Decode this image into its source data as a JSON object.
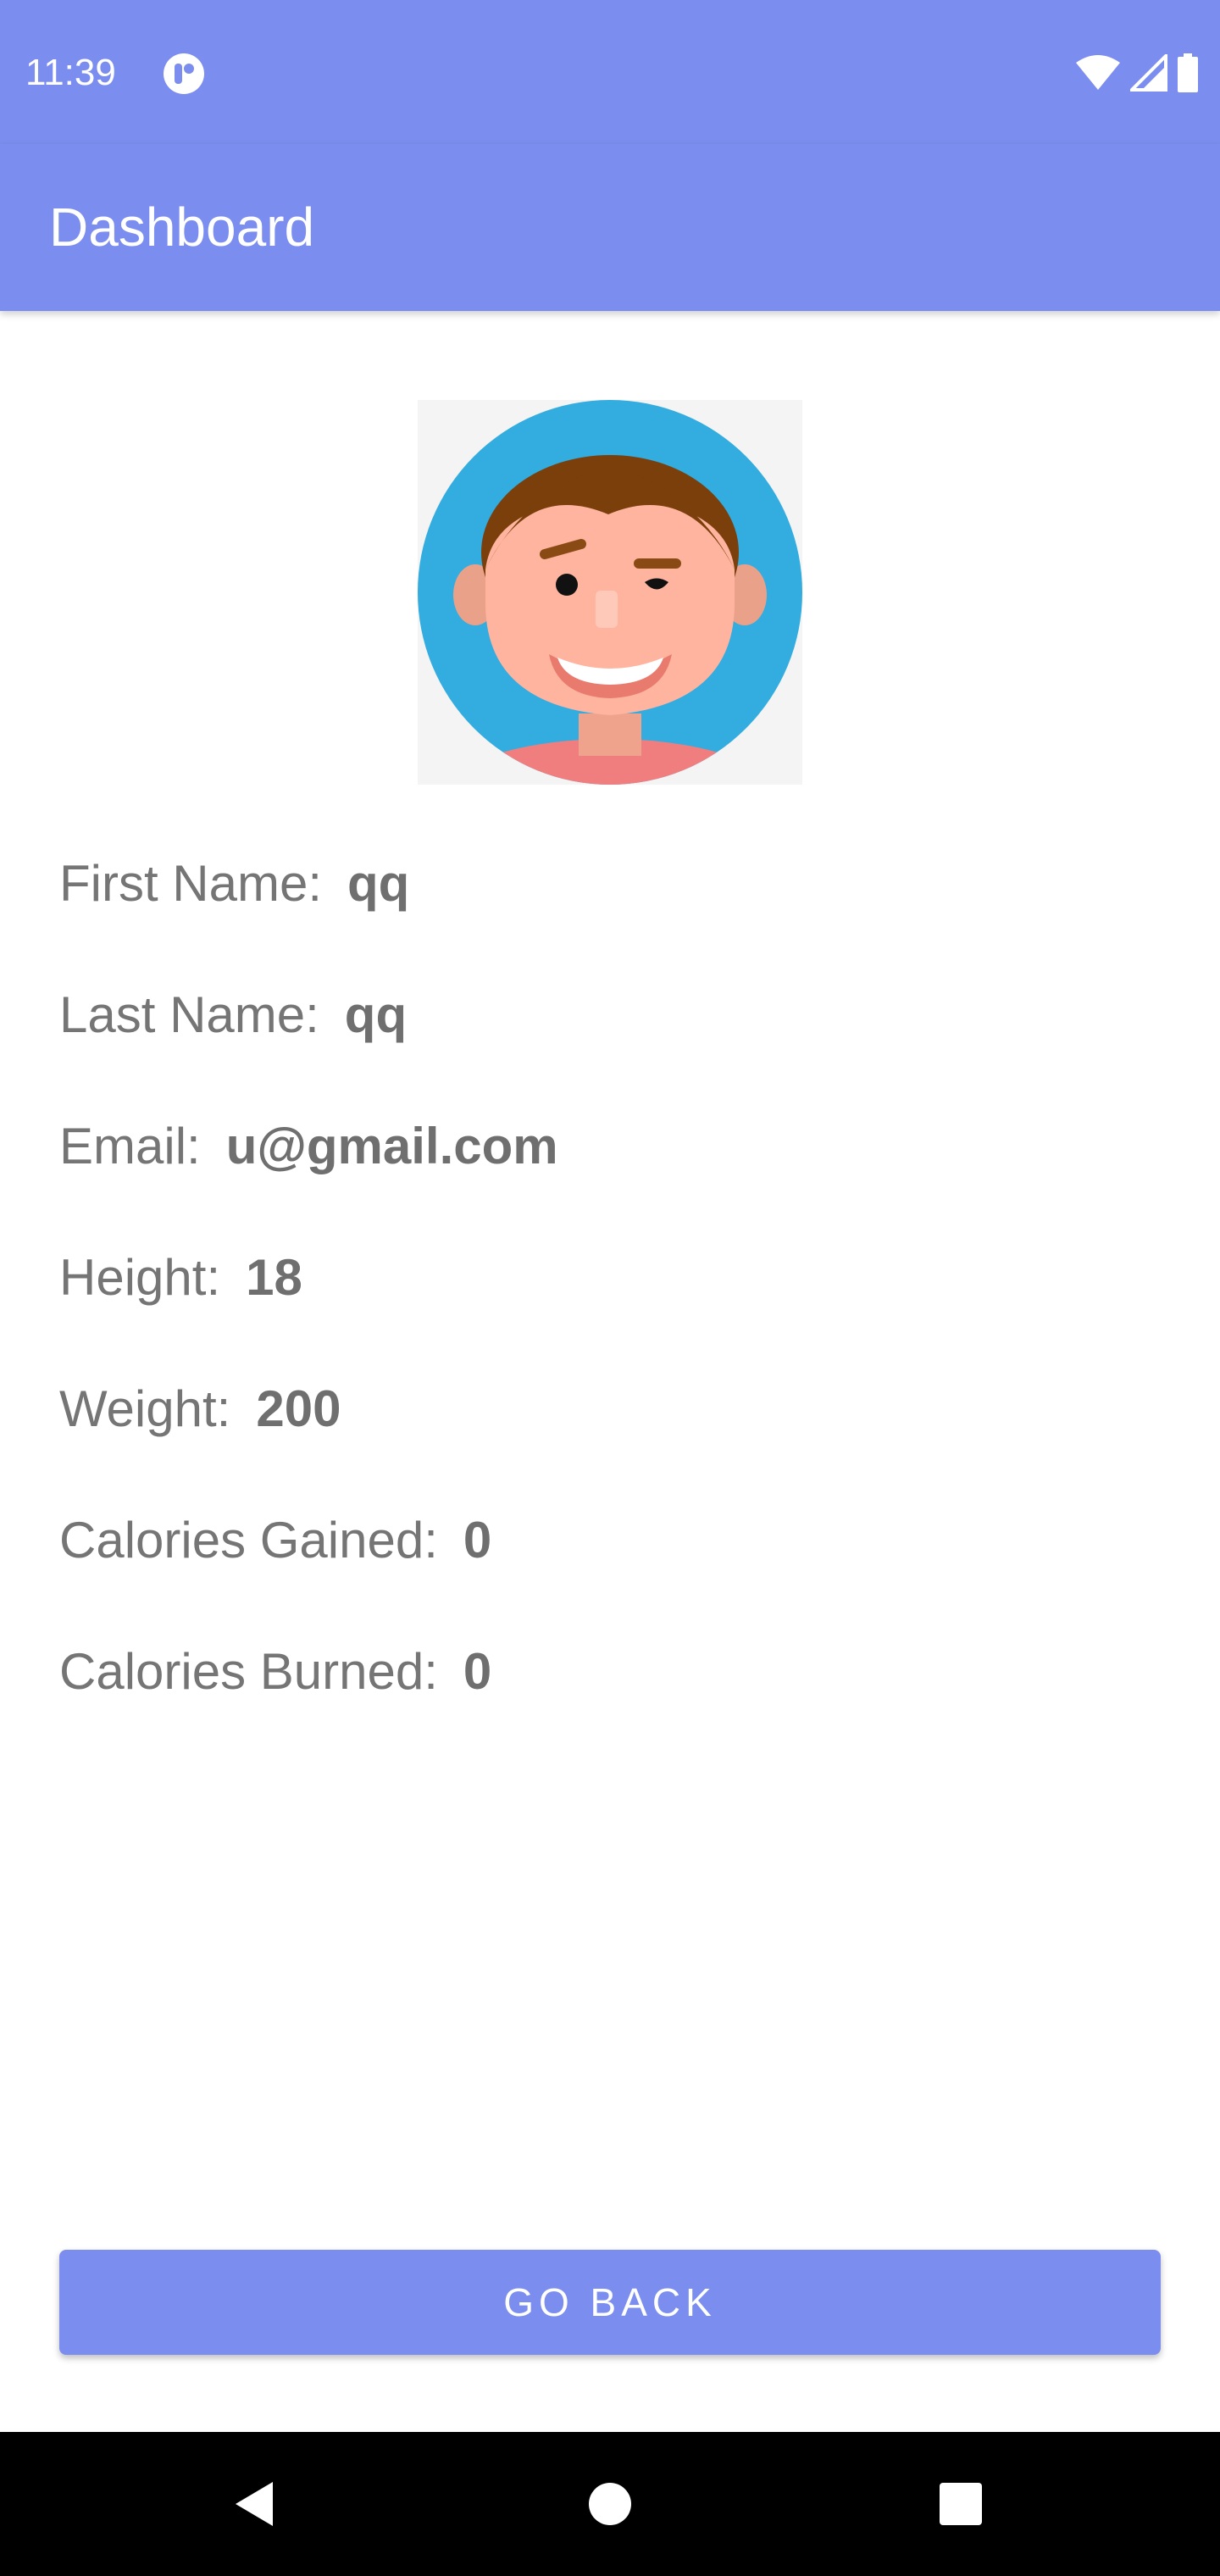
{
  "status_bar": {
    "time": "11:39",
    "app_icon": "profile-app-icon",
    "icons": [
      "wifi-icon",
      "cell-signal-icon",
      "battery-icon"
    ]
  },
  "app_bar": {
    "title": "Dashboard"
  },
  "profile": {
    "avatar_icon": "avatar-icon",
    "fields": [
      {
        "label": "First Name:",
        "value": "qq"
      },
      {
        "label": "Last Name:",
        "value": "qq"
      },
      {
        "label": "Email:",
        "value": "u@gmail.com"
      },
      {
        "label": "Height:",
        "value": "18"
      },
      {
        "label": "Weight:",
        "value": "200"
      },
      {
        "label": "Calories Gained:",
        "value": "0"
      },
      {
        "label": "Calories Burned:",
        "value": "0"
      }
    ]
  },
  "actions": {
    "go_back_label": "GO BACK"
  },
  "nav_bar": {
    "icons": [
      "back-icon",
      "home-icon",
      "recents-icon"
    ]
  },
  "colors": {
    "primary": "#7b8dee",
    "text": "#757575",
    "avatar_bg": "#33acdf"
  }
}
